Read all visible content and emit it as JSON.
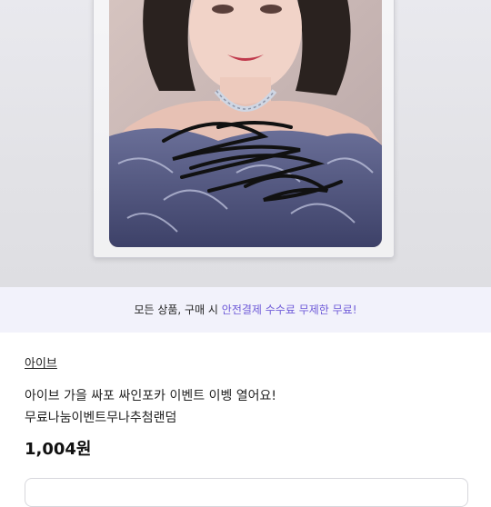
{
  "banner": {
    "prefix": "모든 상품, 구매 시 ",
    "highlight": "안전결제 수수료 무제한 무료!"
  },
  "product": {
    "store": "아이브",
    "title_line1": "아이브 가을 싸포 싸인포카 이벤트 이벵 열어요!",
    "title_line2": "무료나눔이벤트무나추첨랜덤",
    "price": "1,004원"
  }
}
